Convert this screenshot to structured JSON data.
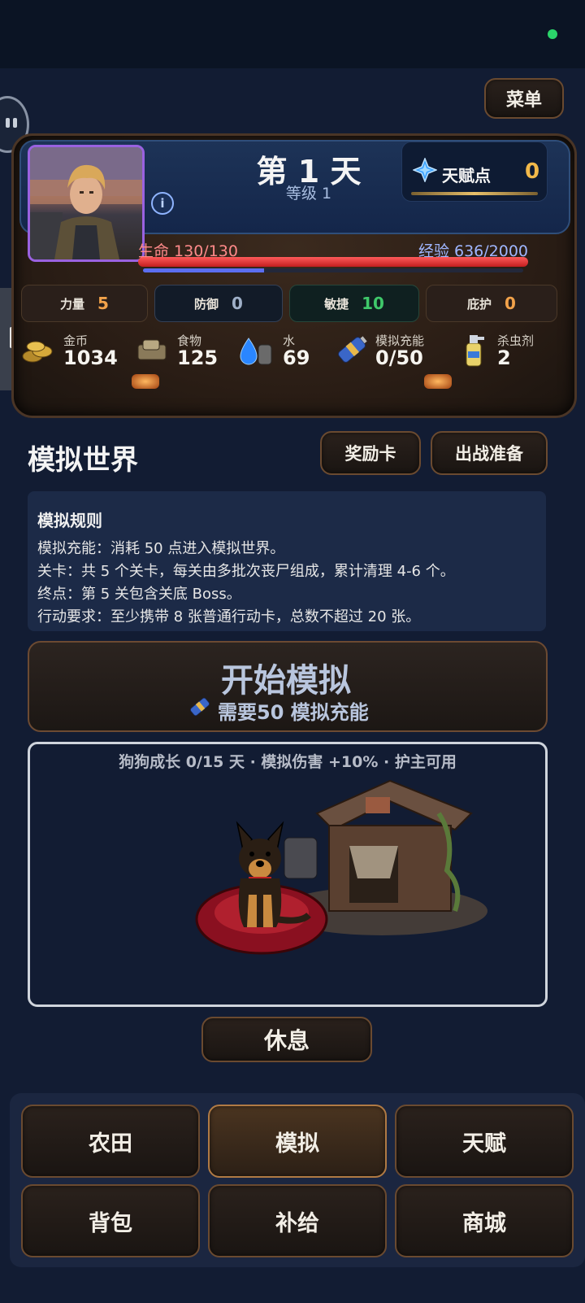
{
  "header": {
    "menu_label": "菜单",
    "day": "第 1 天",
    "level": "等级 1",
    "info_glyph": "i",
    "talent_label": "天赋点",
    "talent_value": "0",
    "hp_label": "生命 130/130",
    "hp_fraction": 1.0,
    "xp_label": "经验 636/2000",
    "xp_fraction": 0.318
  },
  "stats": [
    {
      "name": "力量",
      "value": "5",
      "color": "#f2a24a"
    },
    {
      "name": "防御",
      "value": "0",
      "color": "#9fb0c8"
    },
    {
      "name": "敏捷",
      "value": "10",
      "color": "#3fc86a"
    },
    {
      "name": "庇护",
      "value": "0",
      "color": "#f2a24a"
    }
  ],
  "resources": [
    {
      "name": "金币",
      "value": "1034",
      "icon": "coins-icon"
    },
    {
      "name": "食物",
      "value": "125",
      "icon": "food-icon"
    },
    {
      "name": "水",
      "value": "69",
      "icon": "water-icon"
    },
    {
      "name": "模拟充能",
      "value": "0/50",
      "icon": "battery-icon"
    },
    {
      "name": "杀虫剂",
      "value": "2",
      "icon": "spray-icon"
    }
  ],
  "world": {
    "title": "模拟世界",
    "reward_card": "奖励卡",
    "battle_prep": "出战准备",
    "rules_title": "模拟规则",
    "rules": [
      "模拟充能：消耗 50 点进入模拟世界。",
      "关卡：共 5 个关卡，每关由多批次丧尸组成，累计清理 4-6 个。",
      "终点：第 5 关包含关底 Boss。",
      "行动要求：至少携带 8 张普通行动卡，总数不超过 20 张。"
    ],
    "start_title": "开始模拟",
    "start_sub": "需要50 模拟充能",
    "dog_caption": "狗狗成长 0/15 天 · 模拟伤害 +10% · 护主可用",
    "rest": "休息"
  },
  "nav": [
    "农田",
    "模拟",
    "天赋",
    "背包",
    "补给",
    "商城"
  ],
  "nav_active": 1
}
